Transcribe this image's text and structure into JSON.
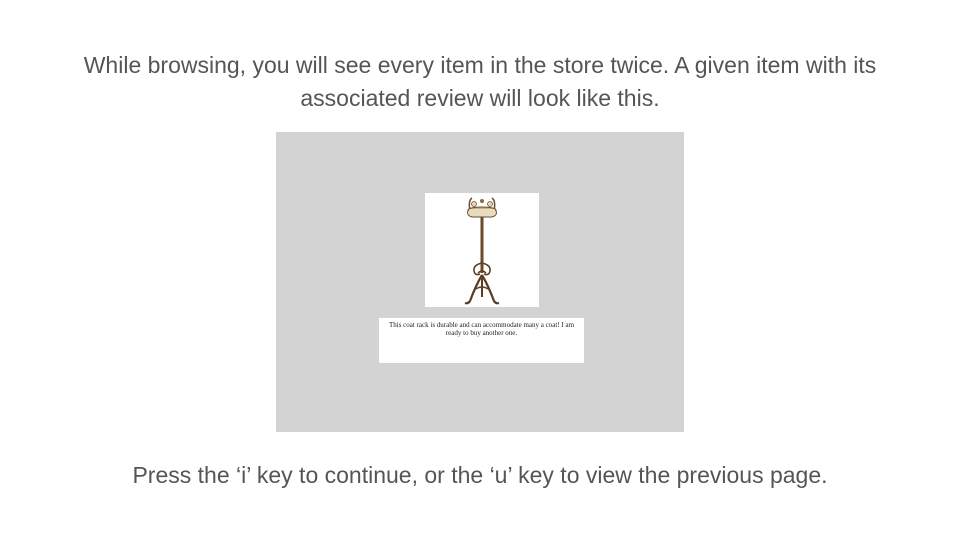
{
  "instructions": {
    "top": "While browsing, you will see every item in the store twice. A given item with its associated review will look like this.",
    "bottom": "Press the ‘i’ key to continue, or the ‘u’ key to view the previous page."
  },
  "example_item": {
    "image_icon": "coat-rack-icon",
    "review_text": "This coat rack is durable and can accommodate many a coat! I am ready to buy another one."
  },
  "colors": {
    "text": "#555555",
    "panel_background": "#d3d3d3",
    "card_background": "#ffffff"
  }
}
